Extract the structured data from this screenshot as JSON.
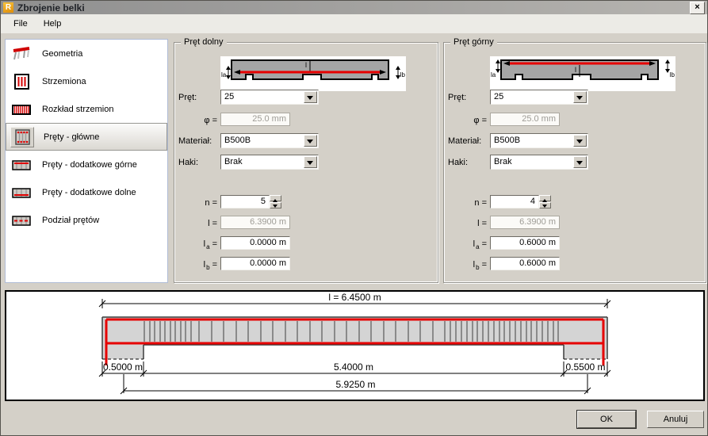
{
  "window": {
    "title": "Zbrojenie belki",
    "app_icon_letter": "R",
    "close_glyph": "×"
  },
  "menu": {
    "items": [
      {
        "label": "File"
      },
      {
        "label": "Help"
      }
    ]
  },
  "sidebar": {
    "items": [
      {
        "label": "Geometria",
        "icon": "geometry-icon",
        "selected": false
      },
      {
        "label": "Strzemiona",
        "icon": "stirrups-icon",
        "selected": false
      },
      {
        "label": "Rozkład strzemion",
        "icon": "stirrup-distribution-icon",
        "selected": false
      },
      {
        "label": "Pręty - główne",
        "icon": "main-bars-icon",
        "selected": true
      },
      {
        "label": "Pręty - dodatkowe górne",
        "icon": "additional-top-bars-icon",
        "selected": false
      },
      {
        "label": "Pręty - dodatkowe dolne",
        "icon": "additional-bottom-bars-icon",
        "selected": false
      },
      {
        "label": "Podział prętów",
        "icon": "bar-division-icon",
        "selected": false
      }
    ]
  },
  "panels": [
    {
      "title": "Pręt dolny",
      "diagram": {
        "l": "l",
        "la": "la",
        "lb": "lb"
      },
      "rows": {
        "pret_label": "Pręt:",
        "pret_value": "25",
        "phi_label": "φ =",
        "phi_value": "25.0 mm",
        "material_label": "Materiał:",
        "material_value": "B500B",
        "haki_label": "Haki:",
        "haki_value": "Brak",
        "n_label": "n =",
        "n_value": "5",
        "l_label": "l =",
        "l_value": "6.3900 m",
        "la_base": "l",
        "la_sub": "a",
        "la_eq": "=",
        "la_value": "0.0000 m",
        "lb_base": "l",
        "lb_sub": "b",
        "lb_eq": "=",
        "lb_value": "0.0000 m"
      }
    },
    {
      "title": "Pręt górny",
      "diagram": {
        "l": "l",
        "la": "la",
        "lb": "lb"
      },
      "rows": {
        "pret_label": "Pręt:",
        "pret_value": "25",
        "phi_label": "φ =",
        "phi_value": "25.0 mm",
        "material_label": "Materiał:",
        "material_value": "B500B",
        "haki_label": "Haki:",
        "haki_value": "Brak",
        "n_label": "n =",
        "n_value": "4",
        "l_label": "l =",
        "l_value": "6.3900 m",
        "la_base": "l",
        "la_sub": "a",
        "la_eq": "=",
        "la_value": "0.6000 m",
        "lb_base": "l",
        "lb_sub": "b",
        "lb_eq": "=",
        "lb_value": "0.6000 m"
      }
    }
  ],
  "beam_drawing": {
    "labels": {
      "total": "l = 6.4500 m",
      "left": "0.5000 m",
      "middle": "5.4000 m",
      "right": "0.5500 m",
      "overall": "5.9250 m"
    },
    "stirrups": [
      174,
      181,
      187,
      194,
      200,
      207,
      213,
      220,
      226,
      233,
      243,
      259,
      274,
      290,
      305,
      321,
      336,
      352,
      367,
      383,
      398,
      414,
      429,
      445,
      460,
      476,
      491,
      507,
      522,
      538,
      553,
      560,
      567,
      574,
      581,
      588,
      594,
      601,
      608,
      615,
      622,
      628,
      635,
      642,
      649,
      656,
      662,
      669,
      676,
      683,
      690,
      696
    ]
  },
  "footer": {
    "ok": "OK",
    "cancel": "Anuluj"
  },
  "colors": {
    "accent_red": "#e60000",
    "dialog_bg": "#d4d0c8",
    "logo_orange": "#ec9a1e",
    "titlebar_gray": "#9c9c9c"
  }
}
